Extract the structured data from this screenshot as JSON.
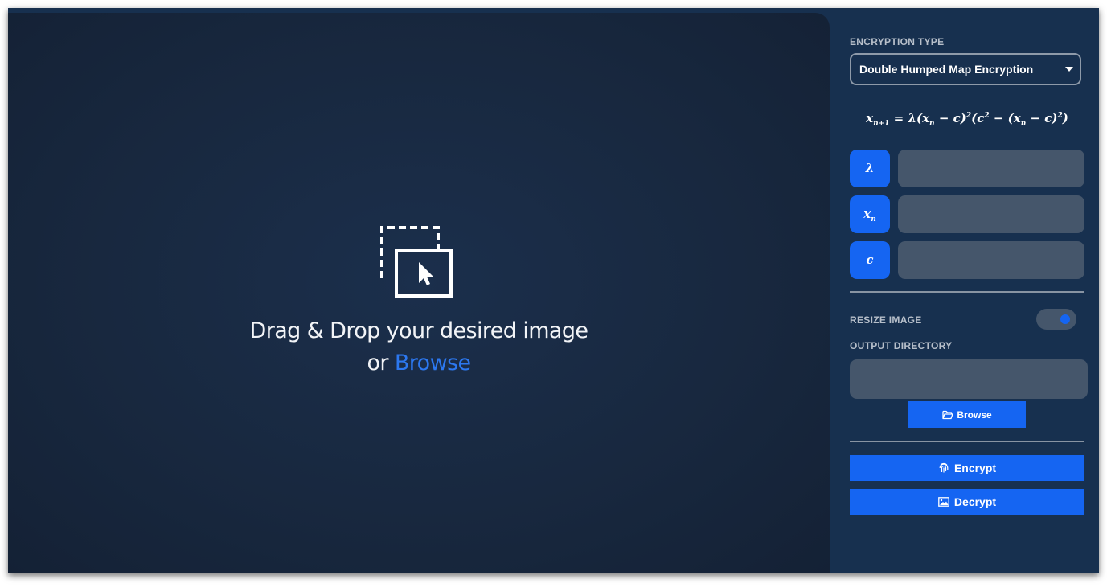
{
  "dropzone": {
    "line1": "Drag & Drop your desired image",
    "or_text": "or",
    "browse_link": "Browse",
    "icon": "drag-drop-image-icon"
  },
  "settings": {
    "encryption_type_label": "ENCRYPTION TYPE",
    "encryption_type_value": "Double Humped Map Encryption",
    "formula": {
      "lhs": "x",
      "lhs_sub": "n+1",
      "eq": " = λ(",
      "x1": "x",
      "x1_sub": "n",
      "m1": " − c)",
      "sup1": "2",
      "m2": "(c",
      "sup2": "2",
      "m3": " − (",
      "x2": "x",
      "x2_sub": "n",
      "m4": " − c)",
      "sup3": "2",
      "m5": ")"
    },
    "params": [
      {
        "symbol": "λ",
        "sub": "",
        "value": ""
      },
      {
        "symbol": "x",
        "sub": "n",
        "value": ""
      },
      {
        "symbol": "c",
        "sub": "",
        "value": ""
      }
    ],
    "resize_label": "RESIZE IMAGE",
    "resize_enabled": true,
    "output_dir_label": "OUTPUT DIRECTORY",
    "output_dir_value": "",
    "browse_button": "Browse",
    "encrypt_button": "Encrypt",
    "decrypt_button": "Decrypt"
  },
  "colors": {
    "accent": "#1565f2",
    "background": "#17304f",
    "input_bg": "#45566b",
    "link": "#2c78f0"
  },
  "icons": {
    "select_caret": "caret-down-icon",
    "folder": "folder-open-icon",
    "fingerprint": "fingerprint-icon",
    "image": "image-icon"
  }
}
